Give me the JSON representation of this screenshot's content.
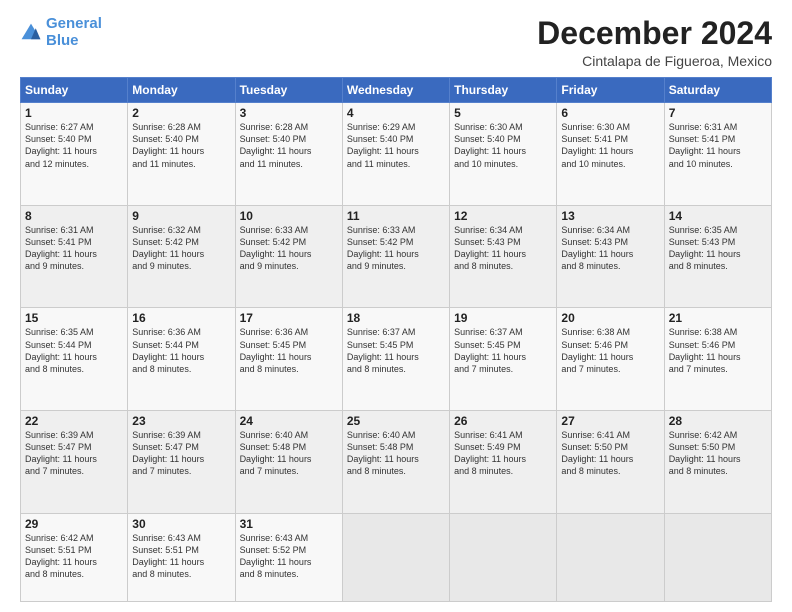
{
  "header": {
    "logo_line1": "General",
    "logo_line2": "Blue",
    "title": "December 2024",
    "subtitle": "Cintalapa de Figueroa, Mexico"
  },
  "weekdays": [
    "Sunday",
    "Monday",
    "Tuesday",
    "Wednesday",
    "Thursday",
    "Friday",
    "Saturday"
  ],
  "weeks": [
    [
      {
        "day": "1",
        "lines": [
          "Sunrise: 6:27 AM",
          "Sunset: 5:40 PM",
          "Daylight: 11 hours",
          "and 12 minutes."
        ]
      },
      {
        "day": "2",
        "lines": [
          "Sunrise: 6:28 AM",
          "Sunset: 5:40 PM",
          "Daylight: 11 hours",
          "and 11 minutes."
        ]
      },
      {
        "day": "3",
        "lines": [
          "Sunrise: 6:28 AM",
          "Sunset: 5:40 PM",
          "Daylight: 11 hours",
          "and 11 minutes."
        ]
      },
      {
        "day": "4",
        "lines": [
          "Sunrise: 6:29 AM",
          "Sunset: 5:40 PM",
          "Daylight: 11 hours",
          "and 11 minutes."
        ]
      },
      {
        "day": "5",
        "lines": [
          "Sunrise: 6:30 AM",
          "Sunset: 5:40 PM",
          "Daylight: 11 hours",
          "and 10 minutes."
        ]
      },
      {
        "day": "6",
        "lines": [
          "Sunrise: 6:30 AM",
          "Sunset: 5:41 PM",
          "Daylight: 11 hours",
          "and 10 minutes."
        ]
      },
      {
        "day": "7",
        "lines": [
          "Sunrise: 6:31 AM",
          "Sunset: 5:41 PM",
          "Daylight: 11 hours",
          "and 10 minutes."
        ]
      }
    ],
    [
      {
        "day": "8",
        "lines": [
          "Sunrise: 6:31 AM",
          "Sunset: 5:41 PM",
          "Daylight: 11 hours",
          "and 9 minutes."
        ]
      },
      {
        "day": "9",
        "lines": [
          "Sunrise: 6:32 AM",
          "Sunset: 5:42 PM",
          "Daylight: 11 hours",
          "and 9 minutes."
        ]
      },
      {
        "day": "10",
        "lines": [
          "Sunrise: 6:33 AM",
          "Sunset: 5:42 PM",
          "Daylight: 11 hours",
          "and 9 minutes."
        ]
      },
      {
        "day": "11",
        "lines": [
          "Sunrise: 6:33 AM",
          "Sunset: 5:42 PM",
          "Daylight: 11 hours",
          "and 9 minutes."
        ]
      },
      {
        "day": "12",
        "lines": [
          "Sunrise: 6:34 AM",
          "Sunset: 5:43 PM",
          "Daylight: 11 hours",
          "and 8 minutes."
        ]
      },
      {
        "day": "13",
        "lines": [
          "Sunrise: 6:34 AM",
          "Sunset: 5:43 PM",
          "Daylight: 11 hours",
          "and 8 minutes."
        ]
      },
      {
        "day": "14",
        "lines": [
          "Sunrise: 6:35 AM",
          "Sunset: 5:43 PM",
          "Daylight: 11 hours",
          "and 8 minutes."
        ]
      }
    ],
    [
      {
        "day": "15",
        "lines": [
          "Sunrise: 6:35 AM",
          "Sunset: 5:44 PM",
          "Daylight: 11 hours",
          "and 8 minutes."
        ]
      },
      {
        "day": "16",
        "lines": [
          "Sunrise: 6:36 AM",
          "Sunset: 5:44 PM",
          "Daylight: 11 hours",
          "and 8 minutes."
        ]
      },
      {
        "day": "17",
        "lines": [
          "Sunrise: 6:36 AM",
          "Sunset: 5:45 PM",
          "Daylight: 11 hours",
          "and 8 minutes."
        ]
      },
      {
        "day": "18",
        "lines": [
          "Sunrise: 6:37 AM",
          "Sunset: 5:45 PM",
          "Daylight: 11 hours",
          "and 8 minutes."
        ]
      },
      {
        "day": "19",
        "lines": [
          "Sunrise: 6:37 AM",
          "Sunset: 5:45 PM",
          "Daylight: 11 hours",
          "and 7 minutes."
        ]
      },
      {
        "day": "20",
        "lines": [
          "Sunrise: 6:38 AM",
          "Sunset: 5:46 PM",
          "Daylight: 11 hours",
          "and 7 minutes."
        ]
      },
      {
        "day": "21",
        "lines": [
          "Sunrise: 6:38 AM",
          "Sunset: 5:46 PM",
          "Daylight: 11 hours",
          "and 7 minutes."
        ]
      }
    ],
    [
      {
        "day": "22",
        "lines": [
          "Sunrise: 6:39 AM",
          "Sunset: 5:47 PM",
          "Daylight: 11 hours",
          "and 7 minutes."
        ]
      },
      {
        "day": "23",
        "lines": [
          "Sunrise: 6:39 AM",
          "Sunset: 5:47 PM",
          "Daylight: 11 hours",
          "and 7 minutes."
        ]
      },
      {
        "day": "24",
        "lines": [
          "Sunrise: 6:40 AM",
          "Sunset: 5:48 PM",
          "Daylight: 11 hours",
          "and 7 minutes."
        ]
      },
      {
        "day": "25",
        "lines": [
          "Sunrise: 6:40 AM",
          "Sunset: 5:48 PM",
          "Daylight: 11 hours",
          "and 8 minutes."
        ]
      },
      {
        "day": "26",
        "lines": [
          "Sunrise: 6:41 AM",
          "Sunset: 5:49 PM",
          "Daylight: 11 hours",
          "and 8 minutes."
        ]
      },
      {
        "day": "27",
        "lines": [
          "Sunrise: 6:41 AM",
          "Sunset: 5:50 PM",
          "Daylight: 11 hours",
          "and 8 minutes."
        ]
      },
      {
        "day": "28",
        "lines": [
          "Sunrise: 6:42 AM",
          "Sunset: 5:50 PM",
          "Daylight: 11 hours",
          "and 8 minutes."
        ]
      }
    ],
    [
      {
        "day": "29",
        "lines": [
          "Sunrise: 6:42 AM",
          "Sunset: 5:51 PM",
          "Daylight: 11 hours",
          "and 8 minutes."
        ]
      },
      {
        "day": "30",
        "lines": [
          "Sunrise: 6:43 AM",
          "Sunset: 5:51 PM",
          "Daylight: 11 hours",
          "and 8 minutes."
        ]
      },
      {
        "day": "31",
        "lines": [
          "Sunrise: 6:43 AM",
          "Sunset: 5:52 PM",
          "Daylight: 11 hours",
          "and 8 minutes."
        ]
      },
      null,
      null,
      null,
      null
    ]
  ]
}
